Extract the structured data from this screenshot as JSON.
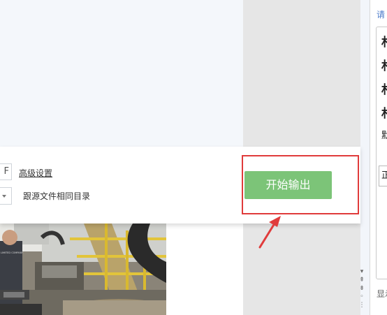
{
  "panel": {
    "format_value_partial": "F",
    "advanced_settings_link": "高级设置",
    "output_dir_label": "跟源文件相同目录",
    "start_button": "开始输出"
  },
  "photo": {
    "nameplate_text": "LIMITED COMPANY"
  },
  "right_panel": {
    "prompt_partial": "请",
    "list_items": [
      "札",
      "札",
      "札",
      "札"
    ],
    "label_partial": "默",
    "input_partial": "正",
    "footer_partial": "显示"
  },
  "scroll_controls": [
    "▾",
    "⇞",
    "⇟",
    "◦",
    "⋮"
  ],
  "colors": {
    "start_button": "#7cc478",
    "highlight_box": "#e03b3b",
    "link": "#4a7ac9"
  }
}
